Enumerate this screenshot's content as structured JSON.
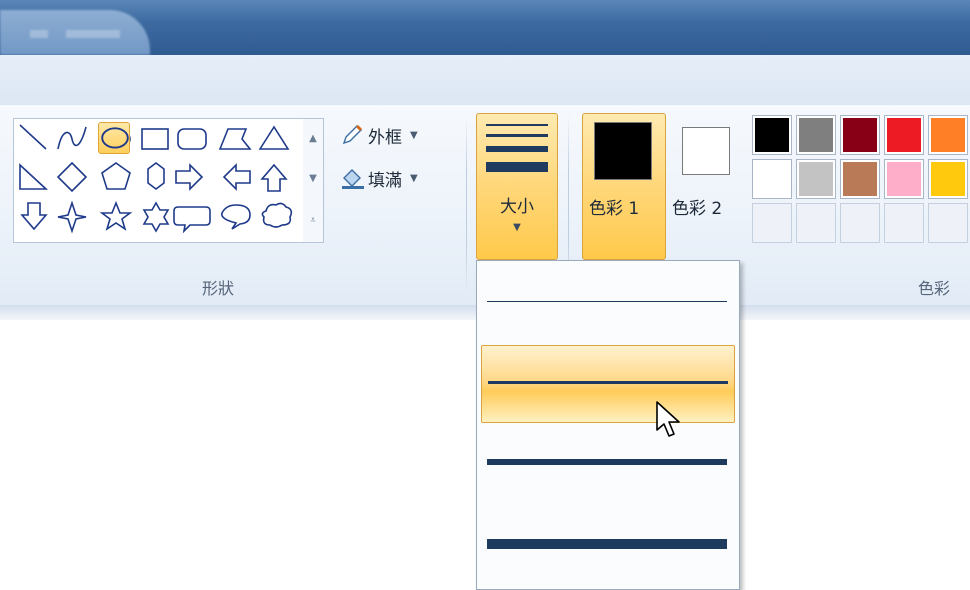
{
  "ribbon": {
    "shapes": {
      "group_label": "形狀",
      "outline_label": "外框",
      "fill_label": "填滿",
      "items": [
        "line",
        "curve",
        "oval",
        "rectangle",
        "rounded-rectangle",
        "polygon",
        "triangle",
        "right-triangle",
        "diamond",
        "pentagon",
        "hexagon",
        "right-arrow",
        "left-arrow",
        "up-arrow",
        "down-arrow",
        "four-point-star",
        "five-point-star",
        "six-point-star",
        "rounded-callout",
        "oval-callout",
        "cloud-callout"
      ],
      "selected": "oval"
    },
    "size": {
      "label": "大小",
      "selected_index": 1,
      "options_count": 4
    },
    "colors": {
      "color1_label": "色彩 1",
      "color2_label": "色彩 2",
      "group_label": "色彩",
      "color1": "#000000",
      "color2": "#ffffff",
      "palette_row1": [
        "#000000",
        "#7f7f7f",
        "#880015",
        "#ed1c24",
        "#ff7f27"
      ],
      "palette_row2": [
        "#ffffff",
        "#c3c3c3",
        "#b97a57",
        "#ffaec9",
        "#ffc90e"
      ]
    }
  },
  "theme": {
    "accent": "#ffc94a",
    "line_color": "#1f3a5f",
    "ribbon_bg": "#edf3fa"
  }
}
